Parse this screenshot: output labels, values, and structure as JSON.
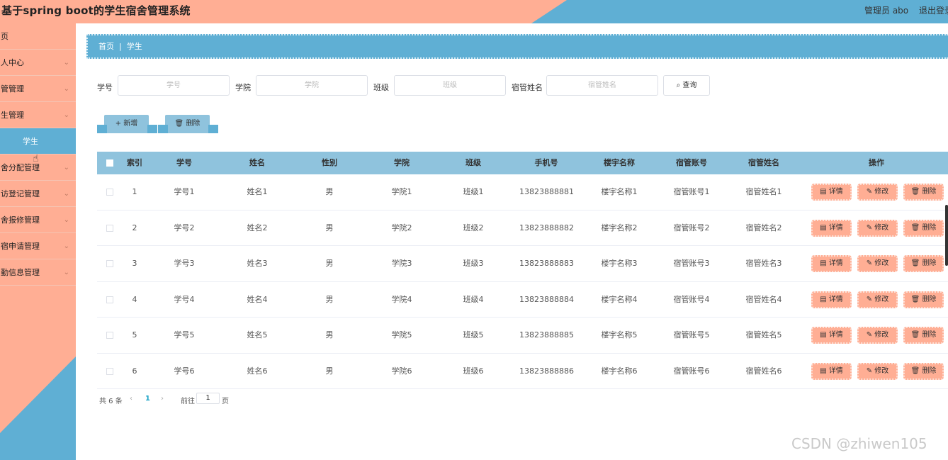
{
  "header": {
    "title": "基于spring boot的学生宿舍管理系统",
    "user": "管理员 abo",
    "logout": "退出登录"
  },
  "sidebar": {
    "items": [
      {
        "label": "页",
        "has_chevron": false
      },
      {
        "label": "人中心",
        "has_chevron": true
      },
      {
        "label": "管管理",
        "has_chevron": true
      },
      {
        "label": "生管理",
        "has_chevron": true
      },
      {
        "label": "学生",
        "sub": true
      },
      {
        "label": "舍分配管理",
        "has_chevron": true
      },
      {
        "label": "访登记管理",
        "has_chevron": true
      },
      {
        "label": "舍报修管理",
        "has_chevron": true
      },
      {
        "label": "宿申请管理",
        "has_chevron": true
      },
      {
        "label": "勤信息管理",
        "has_chevron": true
      }
    ]
  },
  "breadcrumb": {
    "home": "首页",
    "current": "学生"
  },
  "search": {
    "fields": [
      {
        "label": "学号",
        "placeholder": "学号"
      },
      {
        "label": "学院",
        "placeholder": "学院"
      },
      {
        "label": "班级",
        "placeholder": "班级"
      },
      {
        "label": "宿管姓名",
        "placeholder": "宿管姓名"
      }
    ],
    "query_label": "查询"
  },
  "actions": {
    "add_label": "新增",
    "delete_label": "删除"
  },
  "table": {
    "columns": [
      "索引",
      "学号",
      "姓名",
      "性别",
      "学院",
      "班级",
      "手机号",
      "楼宇名称",
      "宿管账号",
      "宿管姓名",
      "操作"
    ],
    "rows": [
      [
        "1",
        "学号1",
        "姓名1",
        "男",
        "学院1",
        "班级1",
        "13823888881",
        "楼宇名称1",
        "宿管账号1",
        "宿管姓名1"
      ],
      [
        "2",
        "学号2",
        "姓名2",
        "男",
        "学院2",
        "班级2",
        "13823888882",
        "楼宇名称2",
        "宿管账号2",
        "宿管姓名2"
      ],
      [
        "3",
        "学号3",
        "姓名3",
        "男",
        "学院3",
        "班级3",
        "13823888883",
        "楼宇名称3",
        "宿管账号3",
        "宿管姓名3"
      ],
      [
        "4",
        "学号4",
        "姓名4",
        "男",
        "学院4",
        "班级4",
        "13823888884",
        "楼宇名称4",
        "宿管账号4",
        "宿管姓名4"
      ],
      [
        "5",
        "学号5",
        "姓名5",
        "男",
        "学院5",
        "班级5",
        "13823888885",
        "楼宇名称5",
        "宿管账号5",
        "宿管姓名5"
      ],
      [
        "6",
        "学号6",
        "姓名6",
        "男",
        "学院6",
        "班级6",
        "13823888886",
        "楼宇名称6",
        "宿管账号6",
        "宿管姓名6"
      ]
    ],
    "row_actions": {
      "detail": "详情",
      "edit": "修改",
      "delete": "删除"
    }
  },
  "pagination": {
    "total": "共 6 条",
    "current_page": "1",
    "goto_prefix": "前往",
    "goto_value": "1",
    "goto_suffix": "页"
  },
  "watermark": "CSDN @zhiwen105",
  "colors": {
    "salmon": "#ffae94",
    "blue": "#5fafd4",
    "header_blue": "#8fc3dd"
  }
}
